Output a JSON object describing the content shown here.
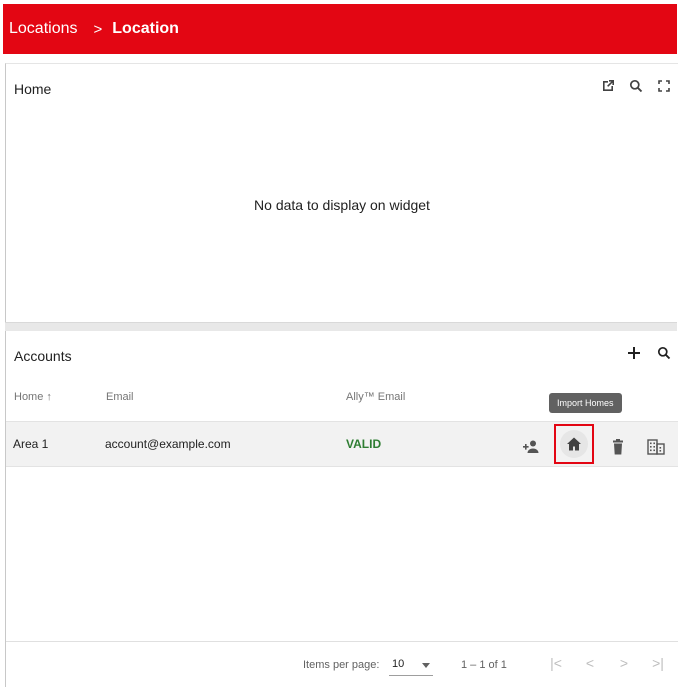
{
  "header": {
    "crumbs": [
      "Locations",
      "Location"
    ],
    "separator": ">",
    "color": "#e30613"
  },
  "home_widget": {
    "title": "Home",
    "empty_message": "No data to display on widget",
    "tools": [
      "open-in-new-icon",
      "search-icon",
      "fullscreen-icon"
    ]
  },
  "accounts": {
    "title": "Accounts",
    "tools": [
      "add-icon",
      "search-icon"
    ],
    "columns": {
      "home": "Home ↑",
      "email": "Email",
      "ally_email": "Ally™ Email"
    },
    "tooltip": "Import Homes",
    "rows": [
      {
        "home": "Area 1",
        "email": "account@example.com",
        "ally_email": "VALID",
        "actions": [
          "add-person-icon",
          "home-icon",
          "delete-icon",
          "building-icon"
        ]
      }
    ],
    "valid_color": "#2e7d32"
  },
  "paginator": {
    "items_per_page_label": "Items per page:",
    "items_per_page": "10",
    "range": "1 – 1 of 1",
    "nav": [
      "|<",
      "<",
      ">",
      ">|"
    ]
  }
}
